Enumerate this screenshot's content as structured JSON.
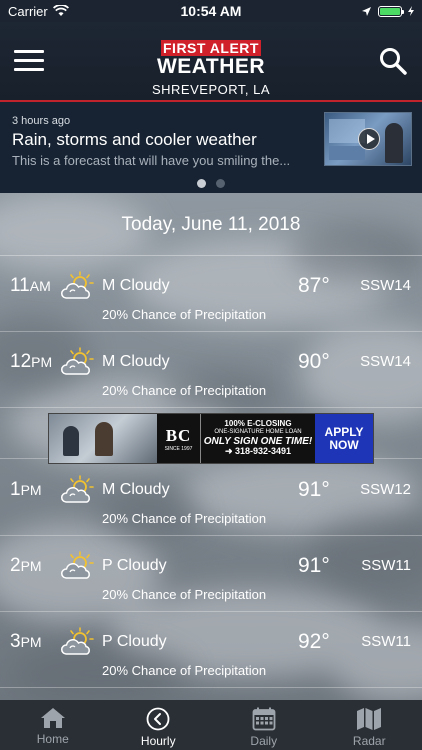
{
  "status_bar": {
    "carrier": "Carrier",
    "time": "10:54 AM"
  },
  "header": {
    "logo_line1": "FIRST ALERT",
    "logo_line2": "WEATHER",
    "location": "SHREVEPORT, LA"
  },
  "news": {
    "ago": "3 hours ago",
    "headline": "Rain, storms and cooler weather",
    "summary": "This is a forecast that will have you smiling the..."
  },
  "date_heading": "Today, June 11, 2018",
  "hours": [
    {
      "hour": "11",
      "ampm": "AM",
      "condition": "M Cloudy",
      "temp": "87°",
      "wind": "SSW14",
      "precip": "20% Chance of Precipitation"
    },
    {
      "hour": "12",
      "ampm": "PM",
      "condition": "M Cloudy",
      "temp": "90°",
      "wind": "SSW14",
      "precip": "20% Chance of Precipitation"
    },
    {
      "hour": "1",
      "ampm": "PM",
      "condition": "M Cloudy",
      "temp": "91°",
      "wind": "SSW12",
      "precip": "20% Chance of Precipitation"
    },
    {
      "hour": "2",
      "ampm": "PM",
      "condition": "P Cloudy",
      "temp": "91°",
      "wind": "SSW11",
      "precip": "20% Chance of Precipitation"
    },
    {
      "hour": "3",
      "ampm": "PM",
      "condition": "P Cloudy",
      "temp": "92°",
      "wind": "SSW11",
      "precip": "20% Chance of Precipitation"
    }
  ],
  "ad": {
    "brand": "BC",
    "since": "SINCE 1997",
    "line1": "100% E-CLOSING",
    "line2": "ONE-SIGNATURE HOME LOAN",
    "line3": "ONLY SIGN ONE TIME!",
    "phone": "➜ 318-932-3491",
    "cta_line1": "APPLY",
    "cta_line2": "NOW"
  },
  "tabs": [
    {
      "label": "Home",
      "icon": "home-icon",
      "active": false
    },
    {
      "label": "Hourly",
      "icon": "clock-icon",
      "active": true
    },
    {
      "label": "Daily",
      "icon": "calendar-icon",
      "active": false
    },
    {
      "label": "Radar",
      "icon": "map-icon",
      "active": false
    }
  ],
  "colors": {
    "accent_red": "#c0232b",
    "header_bg": "#1d2633",
    "tab_active": "#ffffff",
    "tab_inactive": "#9ea4ab",
    "battery": "#4cd964",
    "ad_cta": "#1e35b8"
  }
}
